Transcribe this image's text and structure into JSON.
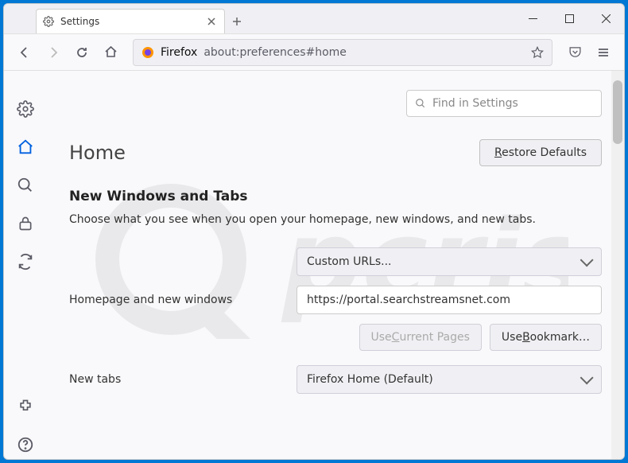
{
  "tab": {
    "title": "Settings"
  },
  "urlbar": {
    "identity": "Firefox",
    "url": "about:preferences#home"
  },
  "search": {
    "placeholder": "Find in Settings"
  },
  "page": {
    "title": "Home",
    "restore": "Restore Defaults",
    "section_title": "New Windows and Tabs",
    "section_desc": "Choose what you see when you open your homepage, new windows, and new tabs."
  },
  "form": {
    "homepage_label": "Homepage and new windows",
    "homepage_select": "Custom URLs...",
    "homepage_url": "https://portal.searchstreamsnet.com",
    "use_current": "Use Current Pages",
    "use_bookmark": "Use Bookmark…",
    "newtabs_label": "New tabs",
    "newtabs_select": "Firefox Home (Default)"
  }
}
